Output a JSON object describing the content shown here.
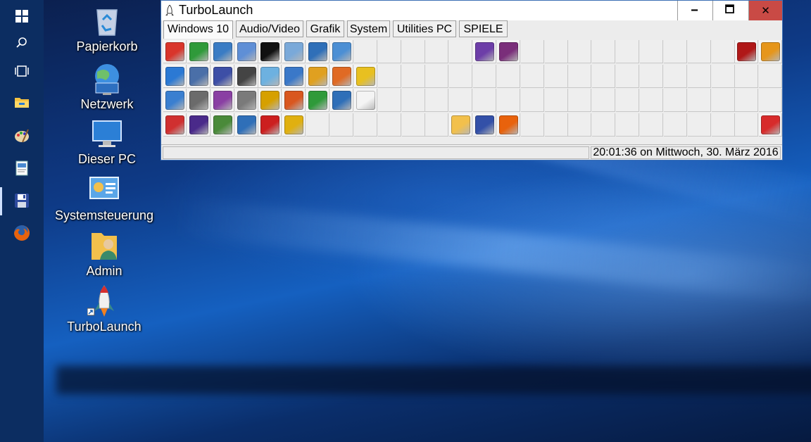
{
  "window": {
    "title": "TurboLaunch",
    "buttons": {
      "minimize": "🗕",
      "maximize": "🗖",
      "close": "✕"
    },
    "tabs": [
      {
        "label": "Windows 10",
        "active": true
      },
      {
        "label": "Audio/Video",
        "active": false
      },
      {
        "label": "Grafik",
        "active": false
      },
      {
        "label": "System",
        "active": false
      },
      {
        "label": "Utilities PC",
        "active": false
      },
      {
        "label": "SPIELE",
        "active": false
      }
    ],
    "status": {
      "datetime": "20:01:36 on Mittwoch, 30. März 2016"
    },
    "grid_rows": [
      [
        "power-icon",
        "hourglass-icon",
        "network-monitor-icon",
        "media-disc-icon",
        "command-prompt-icon",
        "performance-monitor-icon",
        "blocks-icon",
        "window-icon",
        "",
        "",
        "",
        "",
        "",
        "visual-studio-icon",
        "winrar-icon",
        "",
        "",
        "",
        "",
        "",
        "",
        "",
        "",
        "",
        "game-icon",
        "magnifier-icon"
      ],
      [
        "edge-icon",
        "scanner-icon",
        "wizard-icon",
        "calculator-icon",
        "notepad-icon",
        "wordpad-icon",
        "paint-icon",
        "eye-icon",
        "pdf-icon",
        "",
        "",
        "",
        "",
        "",
        "",
        "",
        "",
        "",
        "",
        "",
        "",
        "",
        "",
        "",
        "",
        ""
      ],
      [
        "ccleaner-icon",
        "hardware-icon",
        "base-icon",
        "math-icon",
        "draw-icon",
        "impress-icon",
        "calc-icon",
        "writer-icon",
        "document-icon",
        "",
        "",
        "",
        "",
        "",
        "",
        "",
        "",
        "",
        "",
        "",
        "",
        "",
        "",
        "",
        "",
        ""
      ],
      [
        "ccleaner-brush-icon",
        "cpu-icon",
        "gpu-icon",
        "audio-bars-icon",
        "aida64-icon",
        "disk-tool-icon",
        "",
        "",
        "",
        "",
        "",
        "",
        "explorer-icon",
        "save-icon",
        "firefox-icon",
        "",
        "",
        "",
        "",
        "",
        "",
        "",
        "",
        "",
        "",
        "cancel-icon"
      ]
    ],
    "icon_colors": {
      "power-icon": "#d9352b",
      "hourglass-icon": "#2f9a3a",
      "network-monitor-icon": "#3a7cc4",
      "media-disc-icon": "#5f8fd6",
      "command-prompt-icon": "#111111",
      "performance-monitor-icon": "#7aa9d9",
      "blocks-icon": "#2f6fb8",
      "window-icon": "#4c8fd4",
      "visual-studio-icon": "#6d3ea8",
      "winrar-icon": "#7a2e7a",
      "game-icon": "#b01818",
      "magnifier-icon": "#e6961b",
      "edge-icon": "#2b79d4",
      "scanner-icon": "#4a6fa8",
      "wizard-icon": "#3d4fa6",
      "calculator-icon": "#444444",
      "notepad-icon": "#6db1e0",
      "wordpad-icon": "#3a78c8",
      "paint-icon": "#e0a020",
      "eye-icon": "#e06a24",
      "pdf-icon": "#e8c020",
      "ccleaner-icon": "#3a7fd0",
      "hardware-icon": "#6b6b6b",
      "base-icon": "#8a3fa3",
      "math-icon": "#7a7a7a",
      "draw-icon": "#d6a000",
      "impress-icon": "#d9571f",
      "calc-icon": "#2f9a3a",
      "writer-icon": "#2f6fb8",
      "document-icon": "#f4f4f4",
      "ccleaner-brush-icon": "#d03030",
      "cpu-icon": "#4a2a8a",
      "gpu-icon": "#4a8a3a",
      "audio-bars-icon": "#2f6fb8",
      "aida64-icon": "#cc1f1f",
      "disk-tool-icon": "#e0b010",
      "explorer-icon": "#f2c04c",
      "save-icon": "#3350a8",
      "firefox-icon": "#e8620c",
      "cancel-icon": "#d72b2b"
    }
  },
  "desktop": [
    {
      "label": "Papierkorb",
      "icon": "recycle-bin-icon"
    },
    {
      "label": "Netzwerk",
      "icon": "network-icon"
    },
    {
      "label": "Dieser PC",
      "icon": "computer-icon"
    },
    {
      "label": "Systemsteuerung",
      "icon": "control-panel-icon"
    },
    {
      "label": "Admin",
      "icon": "user-folder-icon"
    },
    {
      "label": "TurboLaunch",
      "icon": "rocket-icon"
    }
  ],
  "taskbar": [
    "start-icon",
    "search-icon",
    "task-view-icon",
    "file-explorer-icon",
    "paint-icon",
    "document-viewer-icon",
    "save-icon",
    "firefox-icon"
  ],
  "accent": "#3c6fb5"
}
